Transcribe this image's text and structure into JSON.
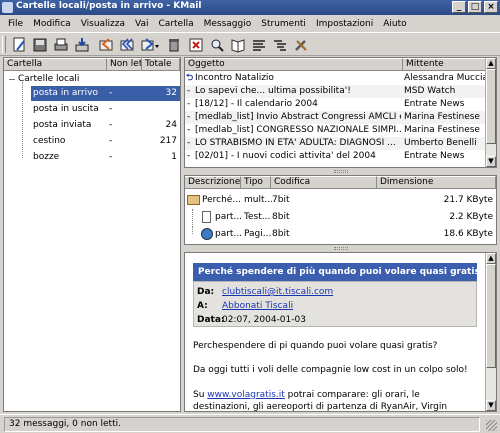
{
  "window": {
    "title": "Cartelle locali/posta in arrivo - KMail"
  },
  "menu": [
    "File",
    "Modifica",
    "Visualizza",
    "Vai",
    "Cartella",
    "Messaggio",
    "Strumenti",
    "Impostazioni",
    "Aiuto"
  ],
  "folders": {
    "headers": {
      "name": "Cartella",
      "unread": "Non letti",
      "total": "Totale"
    },
    "root": "Cartelle locali",
    "items": [
      {
        "name": "posta in arrivo",
        "unread": "-",
        "total": "32",
        "icon": "inbox-icon",
        "selected": true
      },
      {
        "name": "posta in uscita",
        "unread": "-",
        "total": "",
        "icon": "outbox-icon"
      },
      {
        "name": "posta inviata",
        "unread": "-",
        "total": "24",
        "icon": "sent-mail-icon"
      },
      {
        "name": "cestino",
        "unread": "-",
        "total": "217",
        "icon": "trash-icon"
      },
      {
        "name": "bozze",
        "unread": "-",
        "total": "1",
        "icon": "folder-icon"
      }
    ]
  },
  "messages": {
    "headers": {
      "subject": "Oggetto",
      "sender": "Mittente"
    },
    "rows": [
      {
        "subject": "Incontro Natalizio",
        "sender": "Alessandra Muccian",
        "icon": "reply-arrow-icon"
      },
      {
        "subject": "Lo sapevi che... ultima possibilita'!",
        "sender": "MSD Watch"
      },
      {
        "subject": "[18/12] - Il calendario 2004",
        "sender": "Entrate News"
      },
      {
        "subject": "[medlab_list] Invio Abstract Congressi AMCLI e ...",
        "sender": "Marina Festinese"
      },
      {
        "subject": "[medlab_list] CONGRESSO NAZIONALE SIMPI...",
        "sender": "Marina Festinese"
      },
      {
        "subject": "LO STRABISMO IN ETA' ADULTA: DIAGNOSI ...",
        "sender": "Umberto Benelli"
      },
      {
        "subject": "[02/01] - I nuovi codici attivita' del 2004",
        "sender": "Entrate News"
      }
    ]
  },
  "attachments": {
    "headers": {
      "description": "Descrizione",
      "type": "Tipo",
      "encoding": "Codifica",
      "size": "Dimensione"
    },
    "rows": [
      {
        "description": "Perché...",
        "type": "mult...",
        "encoding": "7bit",
        "size": "21.7 KByte",
        "icon": "folder-icon"
      },
      {
        "description": "part...",
        "type": "Test...",
        "encoding": "8bit",
        "size": "2.2 KByte",
        "icon": "text-file-icon"
      },
      {
        "description": "part...",
        "type": "Pagi...",
        "encoding": "8bit",
        "size": "18.6 KByte",
        "icon": "web-page-icon"
      }
    ]
  },
  "reader": {
    "subject": "Perché spendere di più quando puoi volare quasi gratis?",
    "from_label": "Da:",
    "from": "clubtiscali@it.tiscali.com",
    "to_label": "A:",
    "to": "Abbonati Tiscali",
    "date_label": "Data:",
    "date": "02:07, 2004-01-03",
    "p1": "Perchespendere di pi quando puoi volare quasi gratis?",
    "p2": "Da oggi tutti i voli delle compagnie low cost in un colpo solo!",
    "p3_pre": "Su ",
    "p3_link": "www.volagratis.it",
    "p3_post": " potrai comparare: gli orari, le destinazioni, gli aereoporti di partenza di RyanAir, Virgin Express, VolareWeb Air"
  },
  "status": {
    "text": "32 messaggi, 0 non letti."
  },
  "colors": {
    "selection": "#3a5fa8",
    "title_bar": "#3f63a6",
    "reader_header": "#3b5fae",
    "link": "#1a35b0"
  }
}
